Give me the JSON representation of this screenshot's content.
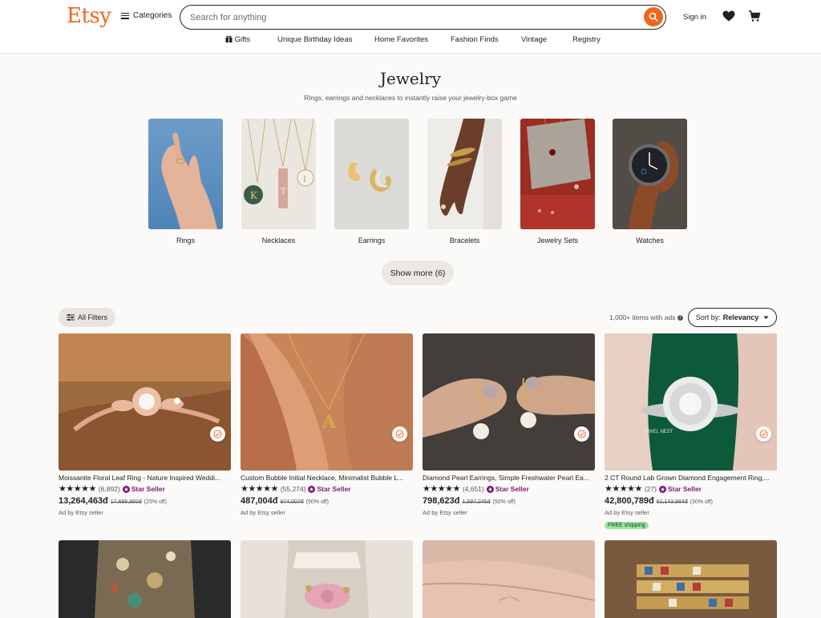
{
  "brand": {
    "logo_text": "Etsy",
    "accent": "#f1641e"
  },
  "header": {
    "categories_label": "Categories",
    "search_placeholder": "Search for anything",
    "sign_in_label": "Sign in"
  },
  "subnav": [
    {
      "label": "Gifts",
      "icon": "gift-icon"
    },
    {
      "label": "Unique Birthday Ideas"
    },
    {
      "label": "Home Favorites"
    },
    {
      "label": "Fashion Finds"
    },
    {
      "label": "Vintage"
    },
    {
      "label": "Registry"
    }
  ],
  "page": {
    "title": "Jewelry",
    "subtitle": "Rings, earrings and necklaces to instantly raise your jewelry-box game"
  },
  "categories": [
    {
      "label": "Rings"
    },
    {
      "label": "Necklaces"
    },
    {
      "label": "Earrings"
    },
    {
      "label": "Bracelets"
    },
    {
      "label": "Jewelry Sets"
    },
    {
      "label": "Watches"
    }
  ],
  "show_more_label": "Show more (6)",
  "filters": {
    "all_filters_label": "All Filters",
    "count_label": "1,000+ items with ads",
    "sort_prefix": "Sort by:",
    "sort_value": "Relevancy"
  },
  "products": [
    {
      "title": "Moissanite Floral Leaf Ring - Nature Inspired Weddi...",
      "stars": "★★★★★",
      "reviews": "(6,892)",
      "star_seller": "Star Seller",
      "price": "13,264,463đ",
      "original_price": "17,685,950đ",
      "discount": "(25% off)",
      "ad_label": "Ad by Etsy seller",
      "free_shipping": ""
    },
    {
      "title": "Custom Bubble Initial Necklace, Minimalist Bubble L...",
      "stars": "★★★★★",
      "reviews": "(55,274)",
      "star_seller": "Star Seller",
      "price": "487,004đ",
      "original_price": "974,007đ",
      "discount": "(50% off)",
      "ad_label": "Ad by Etsy seller",
      "free_shipping": ""
    },
    {
      "title": "Diamond Pearl Earrings, Simple Freshwater Pearl Ea...",
      "stars": "★★★★★",
      "reviews": "(4,651)",
      "star_seller": "Star Seller",
      "price": "798,623đ",
      "original_price": "1,597,245đ",
      "discount": "(50% off)",
      "ad_label": "Ad by Etsy seller",
      "free_shipping": ""
    },
    {
      "title": "2 CT Round Lab Grown Diamond Engagement Ring,...",
      "stars": "★★★★★",
      "reviews": "(27)",
      "star_seller": "Star Seller",
      "price": "42,800,789đ",
      "original_price": "61,143,984đ",
      "discount": "(30% off)",
      "ad_label": "Ad by Etsy seller",
      "free_shipping": "FREE shipping"
    }
  ]
}
